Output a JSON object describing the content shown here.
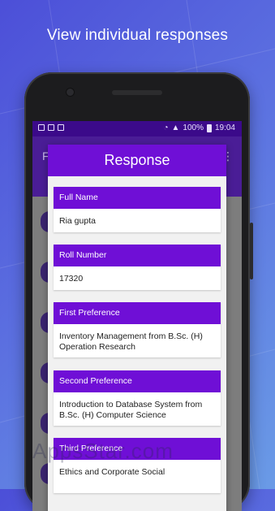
{
  "headline": "View individual responses",
  "status_bar": {
    "battery": "100%",
    "time": "19:04"
  },
  "app_bar": {
    "title_initial": "F",
    "menu_icon": "overflow-menu-icon"
  },
  "dialog": {
    "title": "Response",
    "fields": [
      {
        "label": "Full Name",
        "value": "Ria gupta"
      },
      {
        "label": "Roll Number",
        "value": "17320"
      },
      {
        "label": "First Preference",
        "value": "Inventory Management from B.Sc. (H) Operation Research"
      },
      {
        "label": "Second Preference",
        "value": "Introduction to Database System from B.Sc. (H) Computer Science"
      },
      {
        "label": "Third Preference",
        "value": "Ethics and Corporate Social"
      }
    ]
  },
  "watermark": "AppsStar.com",
  "colors": {
    "primary": "#6f0fd6",
    "primary_dark": "#3b0a8a",
    "background": "#f1f1f1"
  }
}
